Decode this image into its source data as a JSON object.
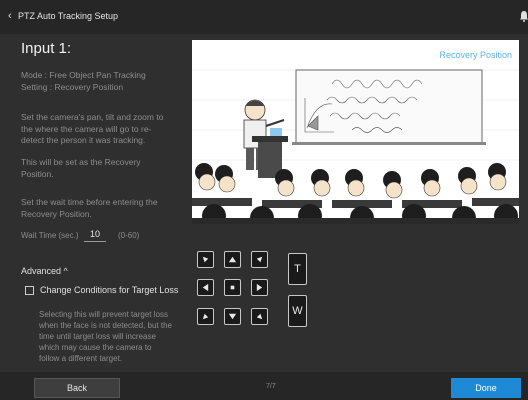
{
  "header": {
    "title": "PTZ Auto Tracking Setup"
  },
  "main": {
    "input_title": "Input 1:",
    "mode": "Mode : Free Object Pan Tracking",
    "setting": "Setting : Recovery Position",
    "instruction": "Set the camera's pan, tilt and zoom to the where the camera will go to re-detect the person it was tracking.",
    "recovery_note": "This will be set as the Recovery Position.",
    "wait_instruction": "Set the wait time before entering the Recovery Position.",
    "wait_label": "Wait Time (sec.)",
    "wait_value": "10",
    "wait_range": "(0-60)",
    "advanced_label": "Advanced ^",
    "checkbox_label": "Change Conditions for Target Loss",
    "checkbox_checked": false,
    "description": "Selecting this will prevent target loss when the face is not detected, but the time until target loss will increase which may cause the camera to follow a different target."
  },
  "preview": {
    "label": "Recovery Position"
  },
  "controls": {
    "zoom_tele": "T",
    "zoom_wide": "W"
  },
  "footer": {
    "back_label": "Back",
    "page_indicator": "7/7",
    "done_label": "Done"
  },
  "colors": {
    "accent": "#1e8ad6",
    "preview_label": "#5ab3e6",
    "background": "#2f2f2f"
  }
}
